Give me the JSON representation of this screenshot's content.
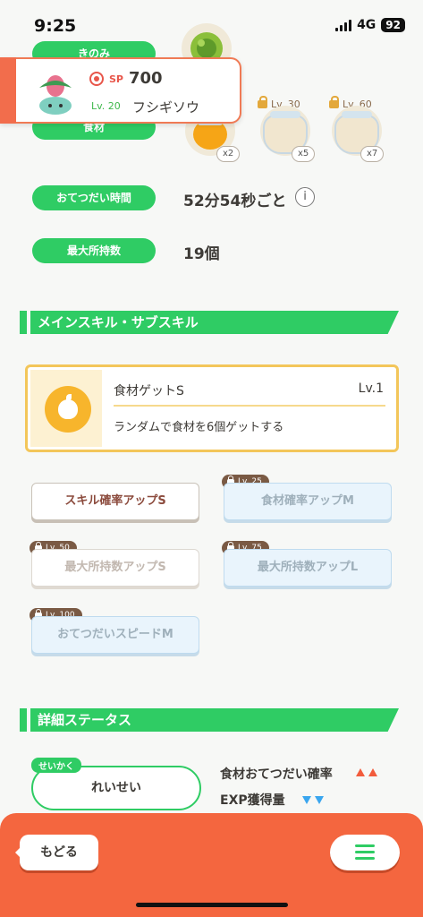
{
  "status_bar": {
    "time": "9:25",
    "network": "4G",
    "battery": "92"
  },
  "labels": {
    "berry": "きのみ",
    "ingredients": "食材",
    "help_time": "おてつだい時間",
    "max_carry": "最大所持数"
  },
  "pokemon": {
    "sp_label": "SP",
    "sp_value": "700",
    "level": "Lv. 20",
    "name": "フシギソウ"
  },
  "ingredients": [
    {
      "icon": "honey-jar-icon",
      "count": "x2",
      "lock_level": ""
    },
    {
      "icon": "milk-jar-icon",
      "count": "x5",
      "lock_level": "Lv. 30"
    },
    {
      "icon": "milk-jar-icon",
      "count": "x7",
      "lock_level": "Lv. 60"
    }
  ],
  "help_time_value": "52分54秒ごと",
  "max_carry_value": "19個",
  "sections": {
    "skills": "メインスキル・サブスキル",
    "details": "詳細ステータス"
  },
  "main_skill": {
    "name": "食材ゲットS",
    "level": "Lv.1",
    "description": "ランダムで食材を6個ゲットする"
  },
  "sub_skills": [
    {
      "label": "スキル確率アップS",
      "lock": ""
    },
    {
      "label": "食材確率アップM",
      "lock": "Lv. 25"
    },
    {
      "label": "最大所持数アップS",
      "lock": "Lv. 50"
    },
    {
      "label": "最大所持数アップL",
      "lock": "Lv. 75"
    },
    {
      "label": "おてつだいスピードM",
      "lock": "Lv. 100"
    }
  ],
  "nature": {
    "tag": "せいかく",
    "value": "れいせい"
  },
  "nature_effects": [
    {
      "label": "食材おてつだい確率",
      "direction": "up"
    },
    {
      "label": "EXP獲得量",
      "direction": "down"
    }
  ],
  "bottom": {
    "back": "もどる"
  },
  "colors": {
    "accent_green": "#2fcc64",
    "accent_orange": "#f4663f",
    "up": "#f25c3c",
    "down": "#3aa6ef"
  }
}
